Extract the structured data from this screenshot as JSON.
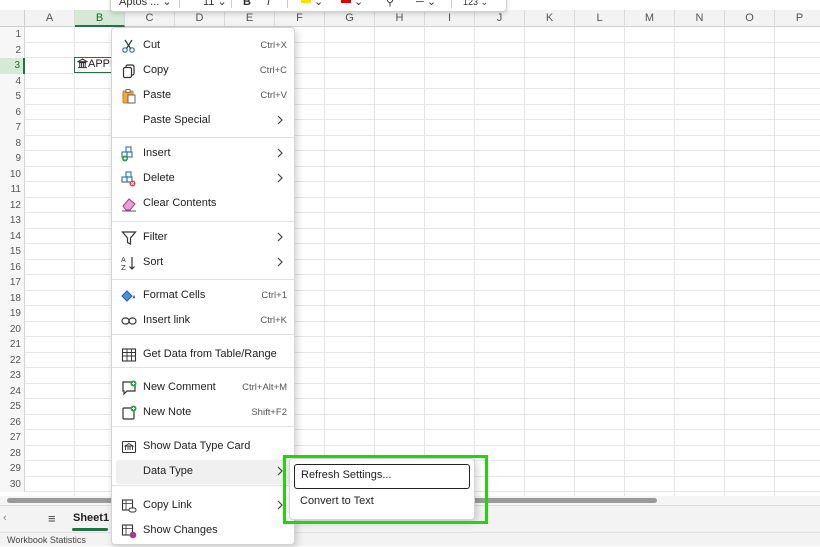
{
  "toolbar": {
    "font_name": "Aptos ...",
    "font_size": "11",
    "bold": "B",
    "italic": "I",
    "number_format": "123"
  },
  "grid": {
    "columns": [
      "A",
      "B",
      "C",
      "D",
      "E",
      "F",
      "G",
      "H",
      "I",
      "J",
      "K",
      "L",
      "M",
      "N",
      "O",
      "P"
    ],
    "rows": [
      "1",
      "2",
      "3",
      "4",
      "5",
      "6",
      "7",
      "8",
      "9",
      "10",
      "11",
      "12",
      "13",
      "14",
      "15",
      "16",
      "17",
      "18",
      "19",
      "20",
      "21",
      "22",
      "23",
      "24",
      "25",
      "26",
      "27",
      "28",
      "29",
      "30"
    ],
    "selected_column": "B",
    "selected_row": "3",
    "cell_b3_value": "APPL"
  },
  "context_menu": {
    "items": [
      {
        "label": "Cut",
        "shortcut": "Ctrl+X",
        "icon": "scissors-icon"
      },
      {
        "label": "Copy",
        "shortcut": "Ctrl+C",
        "icon": "copy-icon"
      },
      {
        "label": "Paste",
        "shortcut": "Ctrl+V",
        "icon": "clipboard-icon"
      },
      {
        "label": "Paste Special",
        "shortcut": "",
        "icon": ""
      },
      {
        "label": "Insert",
        "shortcut": "",
        "icon": "insert-cells-icon"
      },
      {
        "label": "Delete",
        "shortcut": "",
        "icon": "delete-cells-icon"
      },
      {
        "label": "Clear Contents",
        "shortcut": "",
        "icon": "eraser-icon"
      },
      {
        "label": "Filter",
        "shortcut": "",
        "icon": "filter-icon"
      },
      {
        "label": "Sort",
        "shortcut": "",
        "icon": "sort-icon"
      },
      {
        "label": "Format Cells",
        "shortcut": "Ctrl+1",
        "icon": "format-cells-icon"
      },
      {
        "label": "Insert link",
        "shortcut": "Ctrl+K",
        "icon": "link-icon"
      },
      {
        "label": "Get Data from Table/Range",
        "shortcut": "",
        "icon": "table-icon"
      },
      {
        "label": "New Comment",
        "shortcut": "Ctrl+Alt+M",
        "icon": "comment-icon"
      },
      {
        "label": "New Note",
        "shortcut": "Shift+F2",
        "icon": "note-icon"
      },
      {
        "label": "Show Data Type Card",
        "shortcut": "",
        "icon": "data-card-icon"
      },
      {
        "label": "Data Type",
        "shortcut": "",
        "icon": ""
      },
      {
        "label": "Copy Link",
        "shortcut": "",
        "icon": "copy-link-icon"
      },
      {
        "label": "Show Changes",
        "shortcut": "",
        "icon": "show-changes-icon"
      }
    ]
  },
  "submenu": {
    "items": [
      {
        "label": "Refresh Settings..."
      },
      {
        "label": "Convert to Text"
      }
    ]
  },
  "sheet_tabs": {
    "active": "Sheet1"
  },
  "status_bar": {
    "text": "Workbook Statistics"
  },
  "colors": {
    "accent_green": "#217346",
    "highlight_box": "#22d40c",
    "selected_header_bg": "#d6e9d6"
  }
}
